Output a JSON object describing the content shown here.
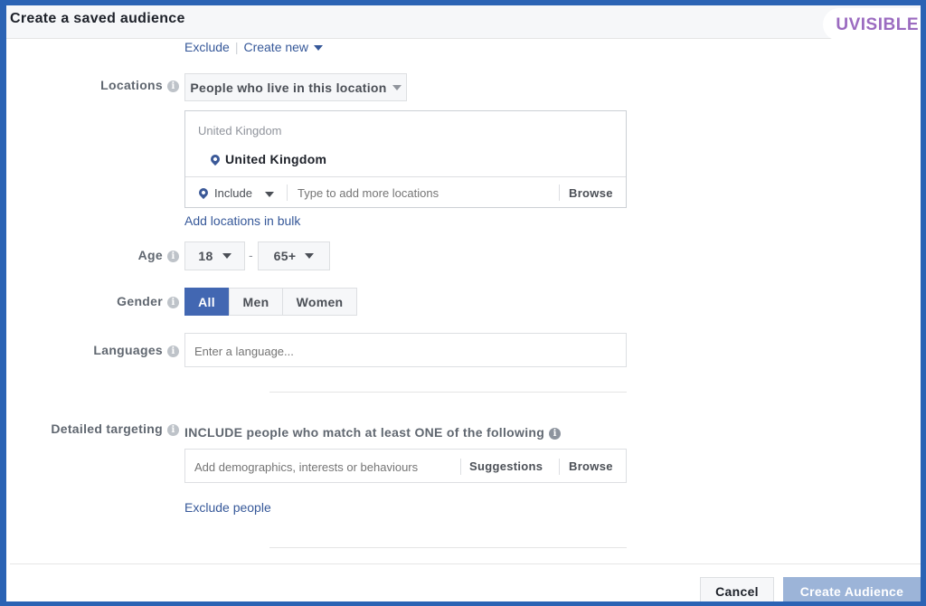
{
  "dialog": {
    "title": "Create a saved audience",
    "brand": "UVISIBLE"
  },
  "top_links": {
    "exclude": "Exclude",
    "create_new": "Create new"
  },
  "locations": {
    "label": "Locations",
    "type_dropdown": "People who live in this location",
    "group_header": "United Kingdom",
    "selected": "United Kingdom",
    "include_dropdown": "Include",
    "search_placeholder": "Type to add more locations",
    "browse": "Browse",
    "bulk_link": "Add locations in bulk"
  },
  "age": {
    "label": "Age",
    "min": "18",
    "separator": "-",
    "max": "65+"
  },
  "gender": {
    "label": "Gender",
    "options": [
      "All",
      "Men",
      "Women"
    ],
    "selected": "All"
  },
  "languages": {
    "label": "Languages",
    "placeholder": "Enter a language..."
  },
  "detailed_targeting": {
    "label": "Detailed targeting",
    "include_text": "INCLUDE people who match at least ONE of the following",
    "placeholder": "Add demographics, interests or behaviours",
    "suggestions": "Suggestions",
    "browse": "Browse",
    "exclude_link": "Exclude people"
  },
  "footer": {
    "cancel": "Cancel",
    "create": "Create Audience"
  },
  "colors": {
    "frame": "#2b63b4",
    "link": "#365899",
    "primary": "#4267b2",
    "primary_disabled": "#9cb4d8",
    "brand": "#9b6bc0"
  }
}
